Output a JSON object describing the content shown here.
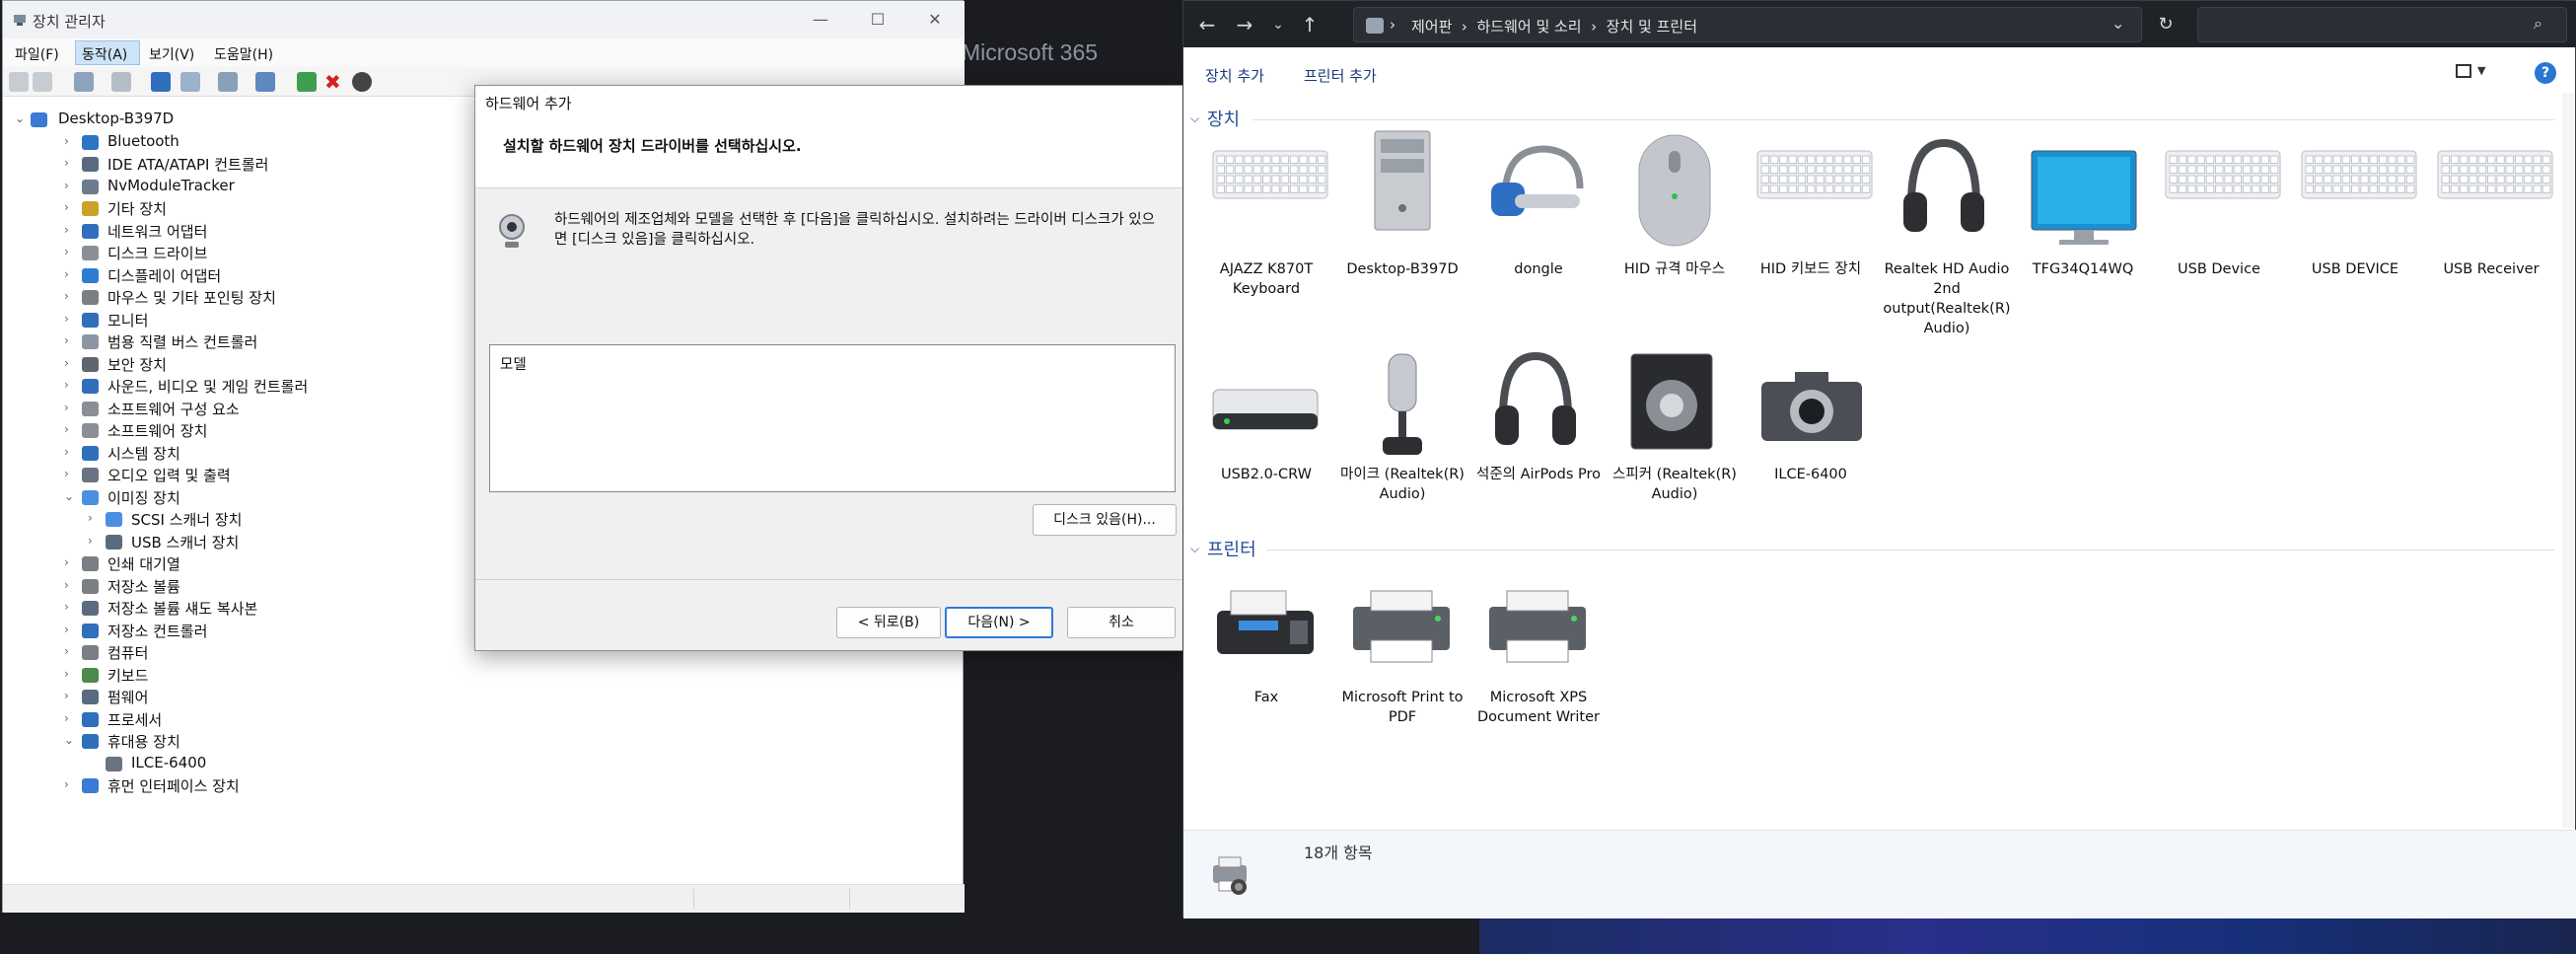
{
  "background": {
    "ms365_text": "Microsoft 365"
  },
  "device_manager": {
    "title": "장치 관리자",
    "menu": [
      "파일(F)",
      "동작(A)",
      "보기(V)",
      "도움말(H)"
    ],
    "tree": [
      {
        "label": "Desktop-B397D",
        "level": 0,
        "expanded": true
      },
      {
        "label": "Bluetooth",
        "level": 1
      },
      {
        "label": "IDE ATA/ATAPI 컨트롤러",
        "level": 1
      },
      {
        "label": "NvModuleTracker",
        "level": 1
      },
      {
        "label": "기타 장치",
        "level": 1
      },
      {
        "label": "네트워크 어댑터",
        "level": 1
      },
      {
        "label": "디스크 드라이브",
        "level": 1
      },
      {
        "label": "디스플레이 어댑터",
        "level": 1
      },
      {
        "label": "마우스 및 기타 포인팅 장치",
        "level": 1
      },
      {
        "label": "모니터",
        "level": 1
      },
      {
        "label": "범용 직렬 버스 컨트롤러",
        "level": 1
      },
      {
        "label": "보안 장치",
        "level": 1
      },
      {
        "label": "사운드, 비디오 및 게임 컨트롤러",
        "level": 1
      },
      {
        "label": "소프트웨어 구성 요소",
        "level": 1
      },
      {
        "label": "소프트웨어 장치",
        "level": 1
      },
      {
        "label": "시스템 장치",
        "level": 1
      },
      {
        "label": "오디오 입력 및 출력",
        "level": 1
      },
      {
        "label": "이미징 장치",
        "level": 1,
        "expanded": true
      },
      {
        "label": "SCSI 스캐너 장치",
        "level": 2
      },
      {
        "label": "USB 스캐너 장치",
        "level": 2
      },
      {
        "label": "인쇄 대기열",
        "level": 1
      },
      {
        "label": "저장소 볼륨",
        "level": 1
      },
      {
        "label": "저장소 볼륨 섀도 복사본",
        "level": 1
      },
      {
        "label": "저장소 컨트롤러",
        "level": 1
      },
      {
        "label": "컴퓨터",
        "level": 1
      },
      {
        "label": "키보드",
        "level": 1
      },
      {
        "label": "펌웨어",
        "level": 1
      },
      {
        "label": "프로세서",
        "level": 1
      },
      {
        "label": "휴대용 장치",
        "level": 1,
        "expanded": true
      },
      {
        "label": "ILCE-6400",
        "level": 2,
        "leaf": true
      },
      {
        "label": "휴먼 인터페이스 장치",
        "level": 1
      }
    ]
  },
  "dialog": {
    "title": "하드웨어 추가",
    "heading": "설치할 하드웨어 장치 드라이버를 선택하십시오.",
    "description": "하드웨어의 제조업체와 모델을 선택한 후 [다음]을 클릭하십시오. 설치하려는 드라이버 디스크가 있으면 [디스크 있음]을 클릭하십시오.",
    "list_header": "모델",
    "have_disk": "디스크 있음(H)...",
    "back": "< 뒤로(B)",
    "next": "다음(N) >",
    "cancel": "취소"
  },
  "devices_printers": {
    "address": "제어판  ›  하드웨어 및 소리  ›  장치 및 프린터",
    "commands": [
      "장치 추가",
      "프린터 추가"
    ],
    "section_devices": "장치",
    "section_printers": "프린터",
    "devices": [
      "AJAZZ K870T Keyboard",
      "Desktop-B397D",
      "dongle",
      "HID 규격 마우스",
      "HID 키보드 장치",
      "Realtek HD Audio 2nd output(Realtek(R) Audio)",
      "TFG34Q14WQ",
      "USB Device",
      "USB DEVICE",
      "USB Receiver",
      "USB2.0-CRW",
      "마이크 (Realtek(R) Audio)",
      "석준의 AirPods Pro",
      "스피커 (Realtek(R) Audio)",
      "ILCE-6400"
    ],
    "printers": [
      "Fax",
      "Microsoft Print to PDF",
      "Microsoft XPS Document Writer"
    ],
    "item_count": "18개 항목"
  }
}
